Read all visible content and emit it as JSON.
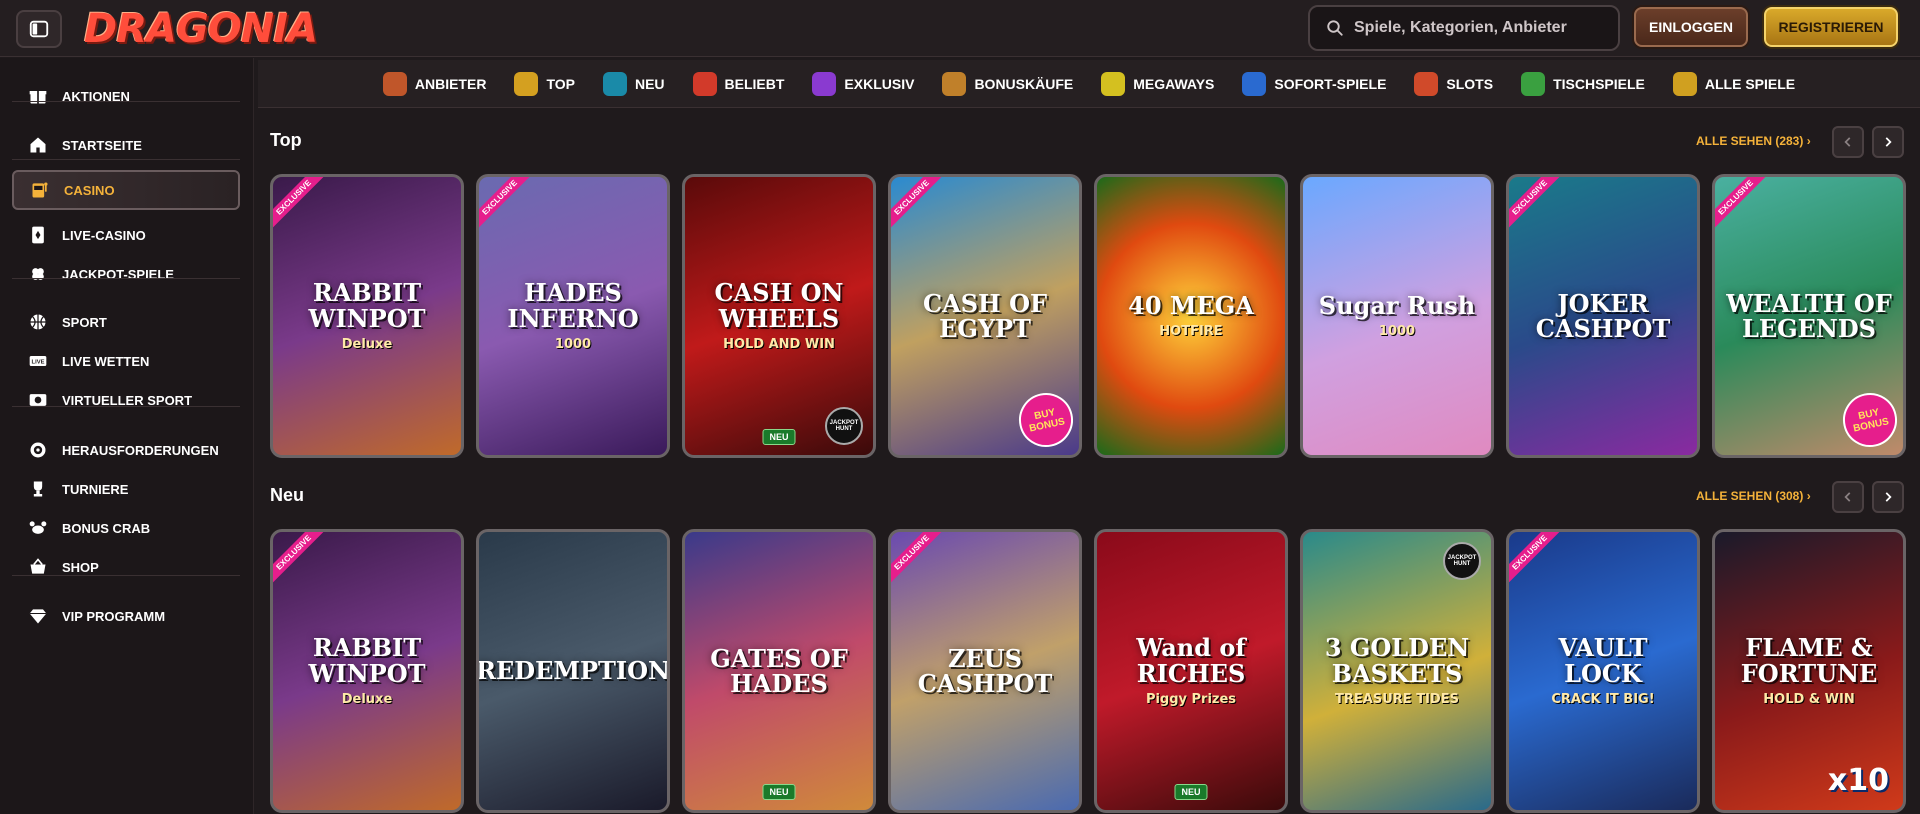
{
  "header": {
    "logo": "DRAGONIA",
    "search_placeholder": "Spiele, Kategorien, Anbieter",
    "login_label": "EINLOGGEN",
    "register_label": "REGISTRIEREN"
  },
  "sidebar": {
    "items": [
      {
        "label": "AKTIONEN",
        "icon": "gift-icon"
      },
      {
        "label": "STARTSEITE",
        "icon": "home-icon"
      },
      {
        "label": "CASINO",
        "icon": "slot-machine-icon",
        "active": true
      },
      {
        "label": "LIVE-CASINO",
        "icon": "card-icon"
      },
      {
        "label": "JACKPOT-SPIELE",
        "icon": "clover-icon"
      },
      {
        "label": "SPORT",
        "icon": "basketball-icon"
      },
      {
        "label": "LIVE WETTEN",
        "icon": "live-icon"
      },
      {
        "label": "VIRTUELLER SPORT",
        "icon": "virtual-sport-icon"
      },
      {
        "label": "HERAUSFORDERUNGEN",
        "icon": "target-icon"
      },
      {
        "label": "TURNIERE",
        "icon": "trophy-icon"
      },
      {
        "label": "BONUS CRAB",
        "icon": "crab-icon"
      },
      {
        "label": "SHOP",
        "icon": "basket-icon"
      },
      {
        "label": "VIP PROGRAMM",
        "icon": "diamond-icon"
      }
    ]
  },
  "categories": [
    {
      "label": "ANBIETER",
      "color": "#c0562a"
    },
    {
      "label": "TOP",
      "color": "#d4a020"
    },
    {
      "label": "NEU",
      "color": "#1a8aa8"
    },
    {
      "label": "BELIEBT",
      "color": "#d23a2a"
    },
    {
      "label": "EXKLUSIV",
      "color": "#8a3ad0"
    },
    {
      "label": "BONUSKÄUFE",
      "color": "#c0802a"
    },
    {
      "label": "MEGAWAYS",
      "color": "#d4c020"
    },
    {
      "label": "SOFORT-SPIELE",
      "color": "#2a6ad0"
    },
    {
      "label": "SLOTS",
      "color": "#d04a2a"
    },
    {
      "label": "TISCHSPIELE",
      "color": "#3aa040"
    },
    {
      "label": "ALLE SPIELE",
      "color": "#d0a020"
    }
  ],
  "sections": [
    {
      "title": "Top",
      "see_all": "ALLE SEHEN (283)",
      "games": [
        {
          "name": "RABBIT WINPOT",
          "sub": "Deluxe",
          "exclusive": true,
          "bg": "linear-gradient(160deg,#3a1a4a,#7a3a8a 50%,#c06a2a)"
        },
        {
          "name": "HADES INFERNO",
          "sub": "1000",
          "exclusive": true,
          "bg": "linear-gradient(160deg,#6a6ab0,#8a5ab0 50%,#3a1a5a)"
        },
        {
          "name": "CASH ON WHEELS",
          "sub": "HOLD AND WIN",
          "new": true,
          "hunt": true,
          "bg": "linear-gradient(160deg,#5a0a0a,#c01a1a 50%,#3a0a0a)"
        },
        {
          "name": "CASH OF EGYPT",
          "sub": "",
          "exclusive": true,
          "bonus": true,
          "bg": "linear-gradient(160deg,#2a8ad0,#c0a060 50%,#4a3a8a)"
        },
        {
          "name": "40 MEGA",
          "sub": "HOTFIRE",
          "bg": "radial-gradient(circle,#ffd43a,#e04a10 55%,#1a6a1a)"
        },
        {
          "name": "Sugar Rush",
          "sub": "1000",
          "bg": "linear-gradient(160deg,#6aa8ff,#d0a0e0 55%,#e08ac0)"
        },
        {
          "name": "JOKER CASHPOT",
          "sub": "",
          "exclusive": true,
          "bg": "linear-gradient(160deg,#1a7a8a,#2a4a8a 50%,#8a2aa0)"
        },
        {
          "name": "WEALTH OF LEGENDS",
          "sub": "",
          "exclusive": true,
          "bonus": true,
          "bg": "linear-gradient(160deg,#4ab0a0,#2a8a5a 50%,#c08a6a)"
        }
      ]
    },
    {
      "title": "Neu",
      "see_all": "ALLE SEHEN (308)",
      "games": [
        {
          "name": "RABBIT WINPOT",
          "sub": "Deluxe",
          "exclusive": true,
          "bg": "linear-gradient(160deg,#3a1a4a,#7a3a8a 50%,#c06a2a)"
        },
        {
          "name": "REDEMPTION",
          "sub": "",
          "bg": "linear-gradient(160deg,#2a3a4a,#4a5a6a 50%,#1a1a2a)"
        },
        {
          "name": "GATES OF HADES",
          "sub": "",
          "new": true,
          "bg": "linear-gradient(160deg,#3a3a8a,#c04a6a 50%,#d08a3a)"
        },
        {
          "name": "ZEUS CASHPOT",
          "sub": "",
          "exclusive": true,
          "bg": "linear-gradient(160deg,#6a4ab0,#c0a06a 50%,#4a6ab0)"
        },
        {
          "name": "Wand of RICHES",
          "sub": "Piggy Prizes",
          "new": true,
          "bg": "linear-gradient(160deg,#8a0a1a,#c01a2a 50%,#3a0a0a)"
        },
        {
          "name": "3 GOLDEN BASKETS",
          "sub": "TREASURE TIDES",
          "hunt_top": true,
          "bg": "linear-gradient(160deg,#2a8a8a,#d0b03a 55%,#2a6a8a)"
        },
        {
          "name": "VAULT LOCK",
          "sub": "CRACK IT BIG!",
          "exclusive": true,
          "bg": "linear-gradient(160deg,#1a3a8a,#2a6ad0 50%,#1a2a5a)"
        },
        {
          "name": "FLAME & FORTUNE",
          "sub": "HOLD & WIN",
          "mult": "x10",
          "bg": "linear-gradient(160deg,#1a1a2a,#8a1a1a 55%,#d03a1a)"
        }
      ]
    }
  ],
  "badges": {
    "exclusive": "EXCLUSIVE",
    "new": "NEU",
    "bonus": "BUY BONUS",
    "hunt": "JACKPOT HUNT"
  }
}
